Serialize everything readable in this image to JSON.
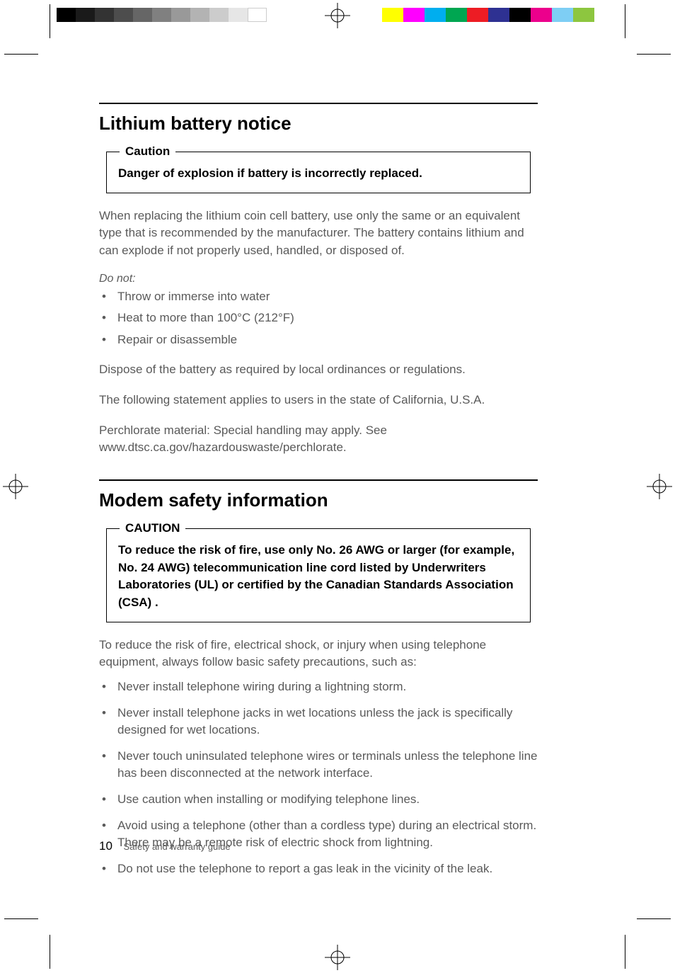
{
  "section1": {
    "title": "Lithium battery notice",
    "caution_label": "Caution",
    "caution_text": "Danger of explosion if battery is incorrectly replaced.",
    "para1": "When replacing the lithium coin cell battery, use only the same or an equivalent type that is recommended by the manufacturer. The battery contains lithium and can explode if not properly used, handled, or disposed of.",
    "donot_label": "Do not:",
    "donot_items": [
      "Throw or immerse into water",
      "Heat to more than 100°C (212°F)",
      "Repair or disassemble"
    ],
    "para2": "Dispose of the battery as required by local ordinances or regulations.",
    "para3": "The following statement applies to users in the state of California, U.S.A.",
    "para4": "Perchlorate material: Special handling may apply. See www.dtsc.ca.gov/hazardouswaste/perchlorate."
  },
  "section2": {
    "title": "Modem safety information",
    "caution_label": "CAUTION",
    "caution_text": "To reduce the risk of fire, use only No. 26 AWG or larger (for example, No. 24 AWG) telecommunication line cord listed by Underwriters Laboratories (UL) or certified by the Canadian Standards Association (CSA) .",
    "para1": "To reduce the risk of fire, electrical shock, or injury when using telephone equipment, always follow basic safety precautions, such as:",
    "items": [
      "Never install telephone wiring during a lightning storm.",
      "Never install telephone jacks in wet locations unless the jack is specifically designed for wet locations.",
      "Never touch uninsulated telephone wires or terminals unless the telephone line has been disconnected at the network interface.",
      "Use caution when installing or modifying telephone lines.",
      "Avoid using a telephone (other than a cordless type) during an electrical storm. There may be a remote risk of electric shock from lightning.",
      "Do not use the telephone to report a gas leak in the vicinity of the leak."
    ]
  },
  "footer": {
    "page_number": "10",
    "doc_title": "Safety and warranty guide"
  },
  "print_marks": {
    "gray_bar": [
      "#000000",
      "#1a1a1a",
      "#333333",
      "#4d4d4d",
      "#666666",
      "#808080",
      "#999999",
      "#b3b3b3",
      "#cccccc",
      "#e6e6e6",
      "#ffffff"
    ],
    "color_bar": [
      "#ffff00",
      "#ff00ff",
      "#00aeef",
      "#00a651",
      "#ed1c24",
      "#2e3192",
      "#000000",
      "#ec008c",
      "#00aeef",
      "#8dc63f"
    ]
  }
}
